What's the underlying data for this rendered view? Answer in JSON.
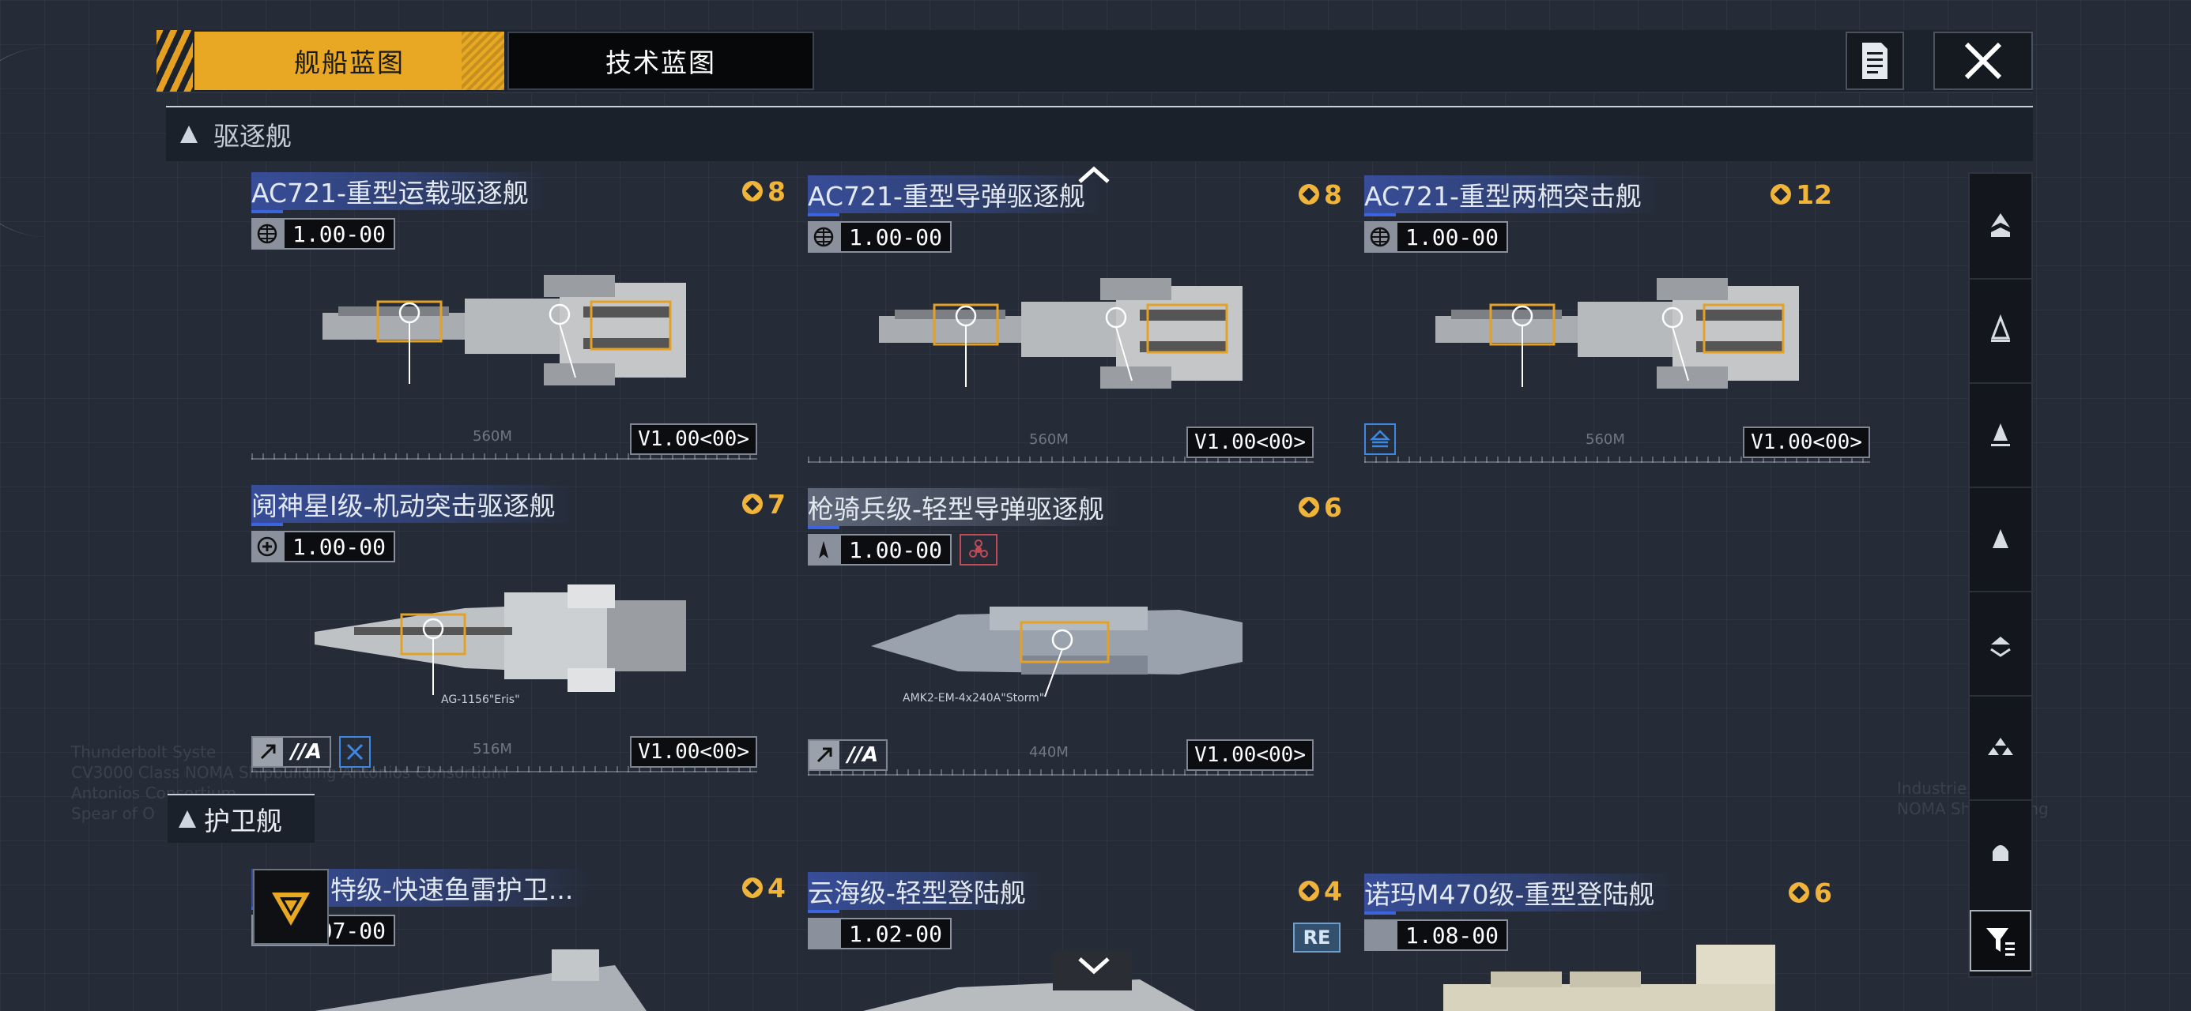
{
  "tabs": [
    {
      "label": "舰船蓝图",
      "active": true
    },
    {
      "label": "技术蓝图",
      "active": false
    }
  ],
  "sections": [
    {
      "label": "驱逐舰"
    },
    {
      "label": "护卫舰"
    }
  ],
  "cards": [
    {
      "title": "AC721-重型运载驱逐舰",
      "cost": "8",
      "value": "1.00-00",
      "dim": "560M",
      "version": "V1.00<00>"
    },
    {
      "title": "AC721-重型导弹驱逐舰",
      "cost": "8",
      "value": "1.00-00",
      "dim": "560M",
      "version": "V1.00<00>"
    },
    {
      "title": "AC721-重型两栖突击舰",
      "cost": "12",
      "value": "1.00-00",
      "dim": "560M",
      "version": "V1.00<00>"
    },
    {
      "title": "阋神星I级-机动突击驱逐舰",
      "cost": "7",
      "value": "1.00-00",
      "dim": "516M",
      "version": "V1.00<00>",
      "tag": "//A",
      "caption": "AG-1156\"Eris\""
    },
    {
      "title": "枪骑兵级-轻型导弹驱逐舰",
      "cost": "6",
      "value": "1.00-00",
      "dim": "440M",
      "version": "V1.00<00>",
      "tag": "//A",
      "caption": "AMK2-EM-4x240A\"Storm\""
    },
    {
      "title": "特级-快速鱼雷护卫...",
      "cost": "4",
      "value": "1.07-00"
    },
    {
      "title": "云海级-轻型登陆舰",
      "cost": "4",
      "value": "1.02-00",
      "badge": "RE"
    },
    {
      "title": "诺玛M470级-重型登陆舰",
      "cost": "6",
      "value": "1.08-00"
    }
  ],
  "bg_text": [
    "Thunderbolt Syste",
    "CV3000 Class NOMA Shipbuilding Antonios Consortium",
    "Antonios Consortium",
    "Spear of O",
    "Industries",
    "NOMA Shipbuilding"
  ],
  "colors": {
    "accent": "#e8a824",
    "title_band": "#3a53aa",
    "cost": "#f0b43a",
    "background": "#252c38"
  },
  "icons": [
    "document-icon",
    "close-icon",
    "globe-icon",
    "filter-icon",
    "class-icons"
  ]
}
